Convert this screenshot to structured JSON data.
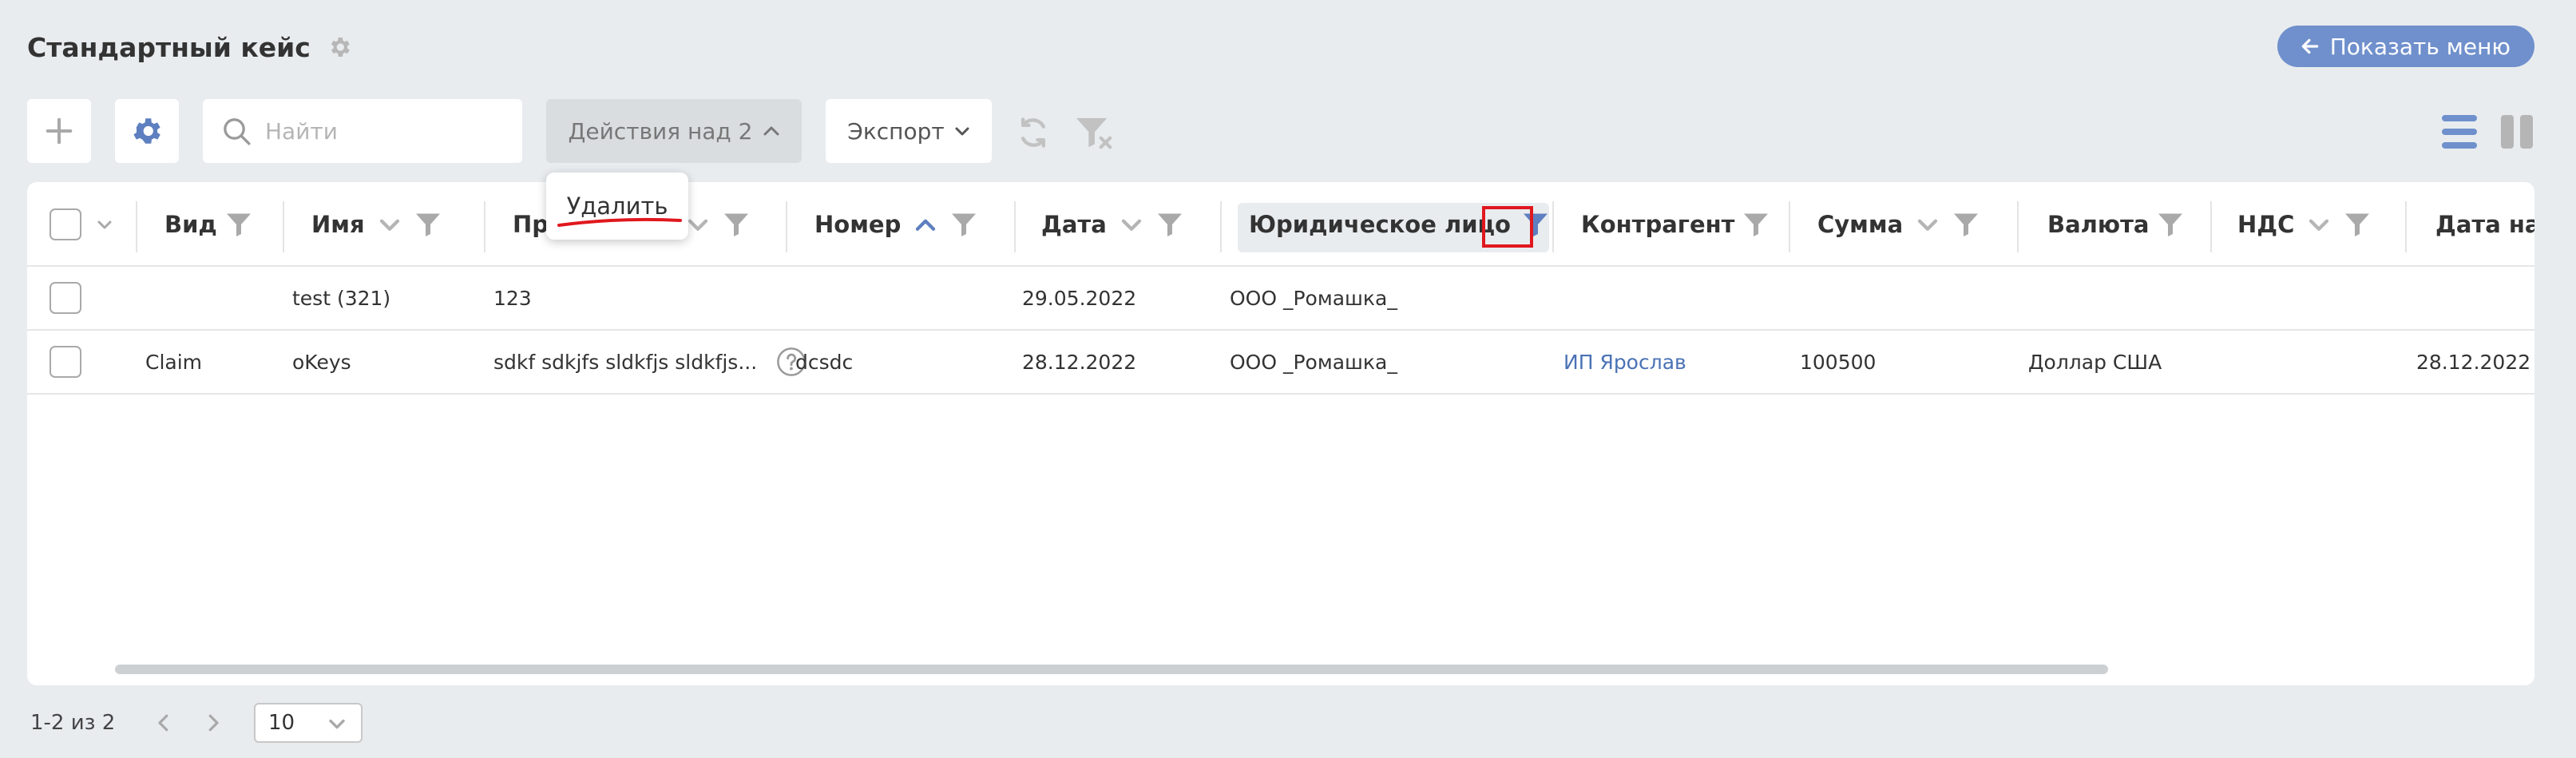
{
  "page": {
    "title": "Стандартный кейс",
    "show_menu_label": "Показать меню"
  },
  "toolbar": {
    "search_placeholder": "Найти",
    "actions_label": "Действия над 2",
    "export_label": "Экспорт"
  },
  "dropdown": {
    "delete_label": "Удалить"
  },
  "table": {
    "columns": [
      {
        "label": "Вид"
      },
      {
        "label": "Имя"
      },
      {
        "label": "Пр"
      },
      {
        "label": "Номер"
      },
      {
        "label": "Дата"
      },
      {
        "label": "Юридическое лицо"
      },
      {
        "label": "Контрагент"
      },
      {
        "label": "Сумма"
      },
      {
        "label": "Валюта"
      },
      {
        "label": "НДС"
      },
      {
        "label": "Дата нач"
      }
    ],
    "rows": [
      {
        "vid": "",
        "name": "test (321)",
        "pr": "123",
        "number": "",
        "date": "29.05.2022",
        "legal": "ООО _Ромашка_",
        "counterparty": "",
        "sum": "",
        "currency": "",
        "nds": "",
        "start": ""
      },
      {
        "vid": "Claim",
        "name": "oKeys",
        "pr": "sdkf sdkjfs sldkfjs sldkfjs...",
        "number": "dcsdc",
        "date": "28.12.2022",
        "legal": "ООО _Ромашка_",
        "counterparty": "ИП Ярослав",
        "sum": "100500",
        "currency": "Доллар США",
        "nds": "",
        "start": "28.12.2022"
      }
    ]
  },
  "pagination": {
    "info": "1-2 из 2",
    "page_size": "10"
  },
  "colors": {
    "accent": "#6f90cc",
    "link": "#4a72b5",
    "highlight_red": "#e0181e"
  },
  "icons": [
    "settings-icon",
    "arrow-left-icon",
    "plus-icon",
    "gear-icon",
    "search-icon",
    "chevron-up-icon",
    "chevron-down-icon",
    "refresh-icon",
    "filter-clear-icon",
    "list-view-icon",
    "column-view-icon",
    "filter-icon",
    "help-icon",
    "chevron-left-icon",
    "chevron-right-icon"
  ]
}
